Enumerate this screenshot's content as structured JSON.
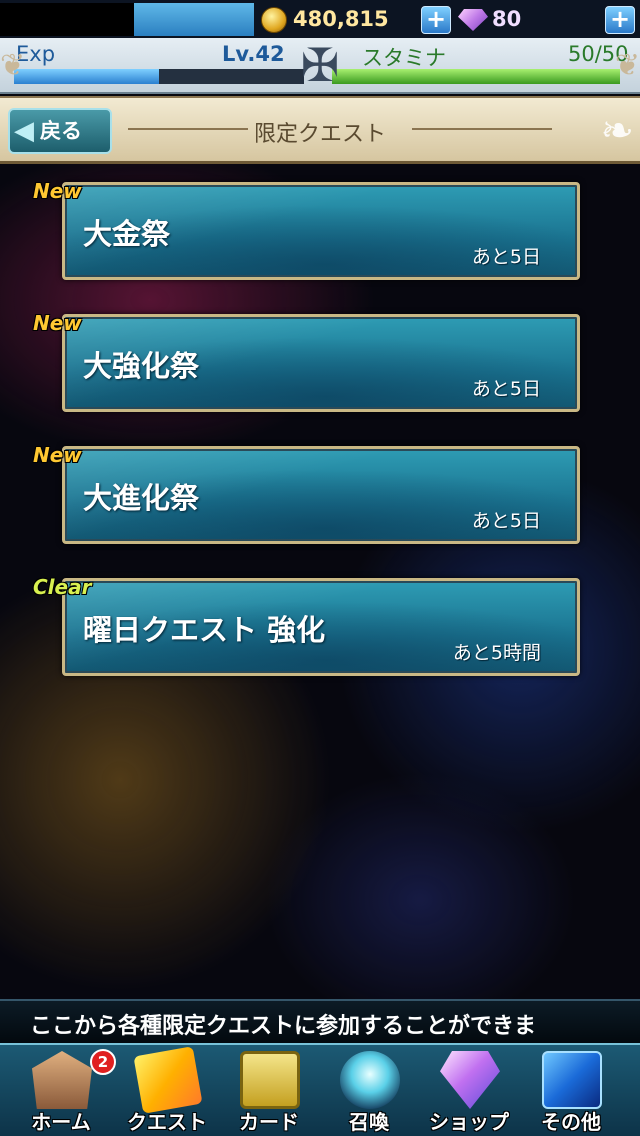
{
  "status": {
    "gold": "480,815",
    "gems": "80",
    "exp_label": "Exp",
    "exp_progress": 0.5,
    "level": "Lv.42",
    "stamina_label": "スタミナ",
    "stamina_value": "50/50",
    "stamina_progress": 1.0
  },
  "header": {
    "back_label": "戻る",
    "title": "限定クエスト"
  },
  "quests": [
    {
      "badge": "New",
      "title": "大金祭",
      "time": "あと5日"
    },
    {
      "badge": "New",
      "title": "大強化祭",
      "time": "あと5日"
    },
    {
      "badge": "New",
      "title": "大進化祭",
      "time": "あと5日"
    },
    {
      "badge": "Clear",
      "title": "曜日クエスト 強化",
      "time": "あと5時間"
    }
  ],
  "ticker": "ここから各種限定クエストに参加することができま",
  "nav": {
    "items": [
      {
        "label": "ホーム",
        "icon": "home-icon"
      },
      {
        "label": "クエスト",
        "icon": "quest-icon"
      },
      {
        "label": "カード",
        "icon": "card-icon"
      },
      {
        "label": "召喚",
        "icon": "summon-icon"
      },
      {
        "label": "ショップ",
        "icon": "shop-icon"
      },
      {
        "label": "その他",
        "icon": "other-icon"
      }
    ],
    "home_badge": "2"
  },
  "colors": {
    "badge_new": "#ffc832",
    "badge_clear": "#d8f050",
    "panel_teal": "#1a7390"
  }
}
